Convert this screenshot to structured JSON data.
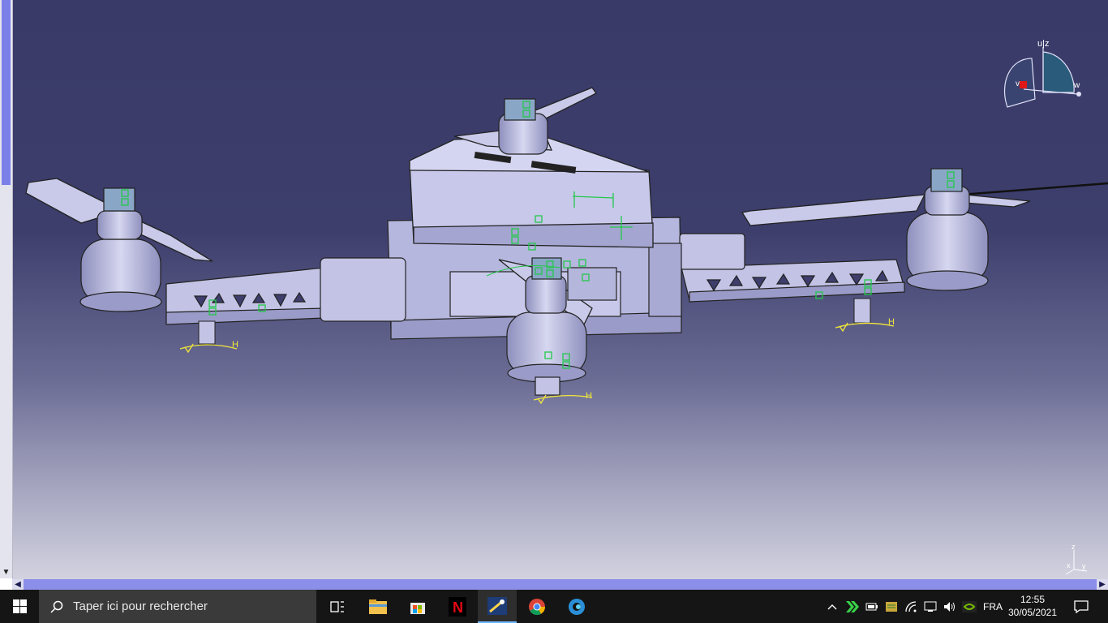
{
  "viewport": {
    "constraint_labels": [
      "H",
      "H",
      "H"
    ],
    "compass_axes": {
      "u": "u|z",
      "v": "v",
      "w": "w"
    },
    "mini_axes": {
      "z": "z",
      "x": "x",
      "y": "y"
    },
    "colors": {
      "background_top": "#393a68",
      "background_bottom": "#d2d2df",
      "part": "#c2c3e5",
      "part_shadow": "#9a9bc8",
      "constraint": "#22c94a",
      "annotation": "#f2e63a"
    }
  },
  "taskbar": {
    "start_icon": "windows-start-icon",
    "search_placeholder": "Taper ici pour rechercher",
    "apps": [
      {
        "name": "task-view-icon"
      },
      {
        "name": "file-explorer-icon"
      },
      {
        "name": "microsoft-store-icon"
      },
      {
        "name": "netflix-icon"
      },
      {
        "name": "catia-icon"
      },
      {
        "name": "chrome-icon"
      },
      {
        "name": "edge-icon"
      }
    ],
    "tray": {
      "language": "FRA",
      "time": "12:55",
      "date": "30/05/2021"
    }
  }
}
